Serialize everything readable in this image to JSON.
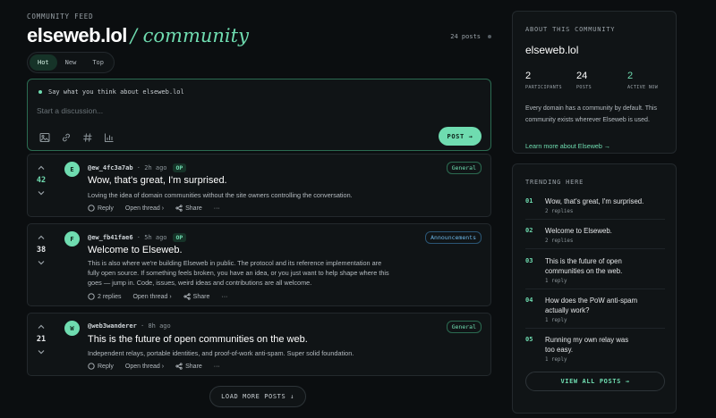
{
  "feed": {
    "eyebrow": "COMMUNITY FEED",
    "title": "elseweb.lol",
    "title_accent": "/ community",
    "post_count": "24 posts",
    "tabs": [
      {
        "label": "Hot",
        "active": true
      },
      {
        "label": "New",
        "active": false
      },
      {
        "label": "Top",
        "active": false
      }
    ]
  },
  "composer": {
    "prompt": "Say what you think about elseweb.lol",
    "placeholder": "Start a discussion...",
    "tools": [
      "image-icon",
      "link-icon",
      "hashtag-icon",
      "chart-icon"
    ],
    "post_label": "POST →"
  },
  "posts": [
    {
      "score": "42",
      "score_highlight": true,
      "avatar": "E",
      "author": "@ew_4fc3a7ab",
      "time": "· 2h ago",
      "op": "OP",
      "tag": "General",
      "title": "Wow, that's great, I'm surprised.",
      "body": "Loving the idea of domain communities without the site owners controlling the conversation.",
      "reply_label": "Reply",
      "open_label": "Open thread ›",
      "share_label": "Share",
      "more_label": "···"
    },
    {
      "score": "38",
      "score_highlight": false,
      "avatar": "F",
      "author": "@ew_fb41fae6",
      "time": "· 5h ago",
      "op": "OP",
      "tag": "Announcements",
      "title": "Welcome to Elseweb.",
      "body": "This is also where we're building Elseweb in public. The protocol and its reference implementation are fully open source. If something feels broken, you have an idea, or you just want to help shape where this goes — jump in. Code, issues, weird ideas and contributions are all welcome.",
      "reply_label": "2 replies",
      "open_label": "Open thread ›",
      "share_label": "Share",
      "more_label": "···"
    },
    {
      "score": "21",
      "score_highlight": false,
      "avatar": "W",
      "author": "@web3wanderer",
      "time": "· 8h ago",
      "op": "",
      "tag": "General",
      "title": "This is the future of open communities on the web.",
      "body": "Independent relays, portable identities, and proof-of-work anti-spam. Super solid foundation.",
      "reply_label": "Reply",
      "open_label": "Open thread ›",
      "share_label": "Share",
      "more_label": "···"
    }
  ],
  "load_more": "LOAD MORE POSTS ↓",
  "about": {
    "heading": "ABOUT THIS COMMUNITY",
    "name": "elseweb.lol",
    "stats": [
      {
        "value": "2",
        "label": "PARTICIPANTS"
      },
      {
        "value": "24",
        "label": "POSTS"
      },
      {
        "value": "2",
        "label": "ACTIVE NOW"
      }
    ],
    "description": "Every domain has a community by default. This community exists wherever Elseweb is used.",
    "link": "Learn more about Elseweb →"
  },
  "trending": {
    "heading": "TRENDING HERE",
    "items": [
      {
        "num": "01",
        "title": "Wow, that's great, I'm surprised.",
        "replies": "2 replies"
      },
      {
        "num": "02",
        "title": "Welcome to Elseweb.",
        "replies": "2 replies"
      },
      {
        "num": "03",
        "title": "This is the future of open communities on the web.",
        "replies": "1 reply"
      },
      {
        "num": "04",
        "title": "How does the PoW anti-spam actually work?",
        "replies": "1 reply"
      },
      {
        "num": "05",
        "title": "Running my own relay was too easy.",
        "replies": "1 reply"
      }
    ],
    "view_all": "VIEW ALL POSTS →"
  },
  "colors": {
    "accent": "#6fdcb0",
    "background": "#0b0e10",
    "card": "#101416",
    "tag_blue": "#6cb7e8"
  }
}
